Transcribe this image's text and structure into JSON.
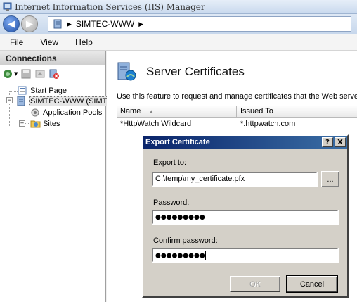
{
  "window": {
    "title": "Internet Information Services (IIS) Manager"
  },
  "address": {
    "segment": "SIMTEC-WWW"
  },
  "menu": {
    "file": "File",
    "view": "View",
    "help": "Help"
  },
  "connections": {
    "header": "Connections",
    "tree": {
      "start_page": "Start Page",
      "server": "SIMTEC-WWW (SIMTEC",
      "app_pools": "Application Pools",
      "sites": "Sites"
    }
  },
  "main": {
    "title": "Server Certificates",
    "description": "Use this feature to request and manage certificates that the Web server ca",
    "columns": {
      "name": "Name",
      "issued_to": "Issued To"
    },
    "rows": [
      {
        "name": "*HttpWatch Wildcard",
        "issued_to": "*.httpwatch.com"
      }
    ]
  },
  "dialog": {
    "title": "Export Certificate",
    "help_glyph": "?",
    "close_glyph": "X",
    "export_label": "Export to:",
    "export_value": "C:\\temp\\my_certificate.pfx",
    "browse_label": "...",
    "password_label": "Password:",
    "password_value": "●●●●●●●●●",
    "confirm_label": "Confirm password:",
    "confirm_value": "●●●●●●●●●",
    "ok_label": "OK",
    "cancel_label": "Cancel"
  },
  "colors": {
    "dialog_title_start": "#0a246a",
    "dialog_title_end": "#3a6ea5",
    "dialog_face": "#d4d0c8"
  }
}
